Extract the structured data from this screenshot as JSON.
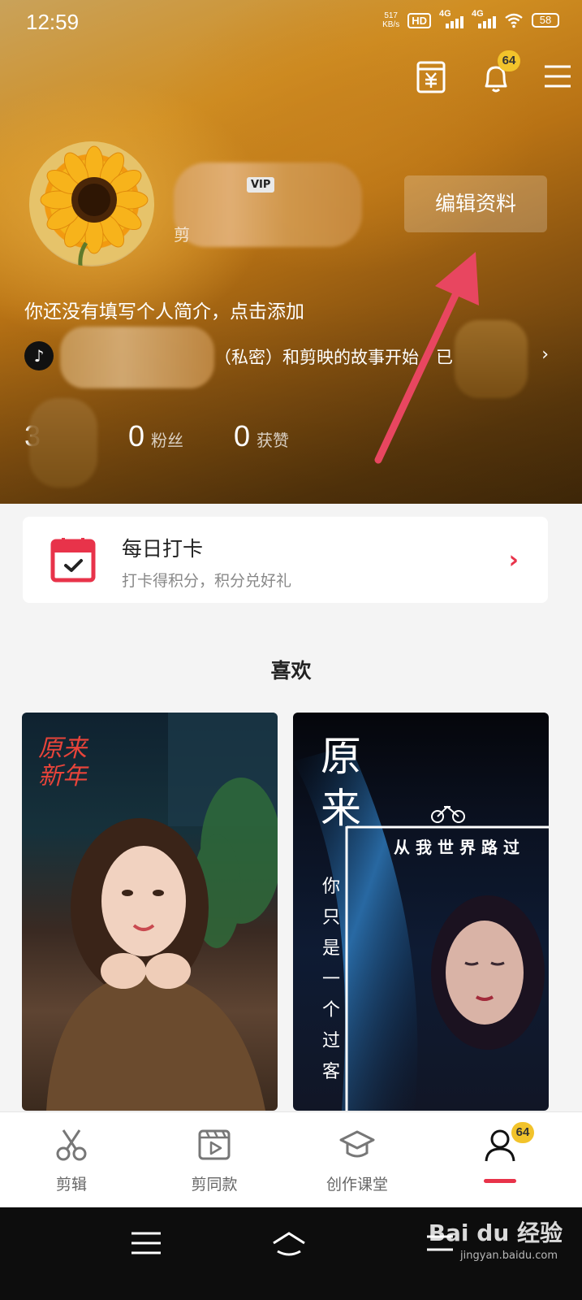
{
  "status_bar": {
    "time": "12:59",
    "net_speed": "517",
    "net_unit": "KB/s",
    "hd": "HD",
    "signal1": "4G",
    "signal2": "4G",
    "battery": "58"
  },
  "header": {
    "notification_count": "64",
    "edit_profile_label": "编辑资料",
    "vip_label": "VIP",
    "subname_prefix": "剪",
    "bio_prompt": "你还没有填写个人简介，点击添加",
    "tiktok_text": "（私密）和剪映的故事开始，已",
    "stats": [
      {
        "num": "3",
        "label": ""
      },
      {
        "num": "0",
        "label": "粉丝"
      },
      {
        "num": "0",
        "label": "获赞"
      }
    ]
  },
  "checkin": {
    "title": "每日打卡",
    "subtitle": "打卡得积分，积分兑好礼"
  },
  "likes": {
    "title": "喜欢",
    "thumb_left_text": "原来新年",
    "thumb_right_big": "原来",
    "thumb_right_line": "从我世界路过",
    "thumb_right_vertical": "你只是一个过客"
  },
  "bottom_nav": {
    "items": [
      {
        "label": "剪辑",
        "icon": "scissors-icon"
      },
      {
        "label": "剪同款",
        "icon": "template-icon"
      },
      {
        "label": "创作课堂",
        "icon": "graduation-cap-icon"
      },
      {
        "label": "",
        "icon": "person-icon"
      }
    ],
    "profile_badge": "64"
  },
  "watermark": {
    "text": "Bai du 经验",
    "sub": "jingyan.baidu.com"
  },
  "colors": {
    "accent": "#e8334a",
    "badge": "#f2c32b"
  }
}
